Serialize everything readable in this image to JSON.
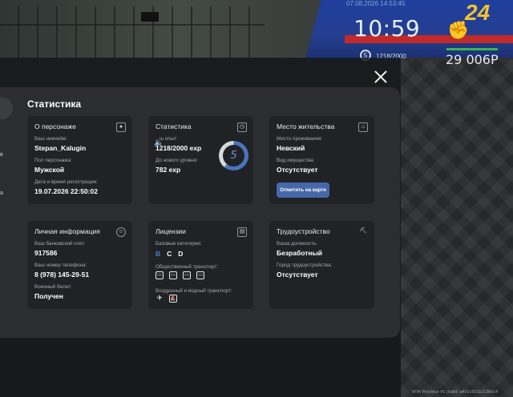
{
  "hud": {
    "date": "07.08.2026 14:53:45",
    "time": "10:59",
    "level": "5",
    "exp": "1218/2000",
    "money": "29 006Р",
    "health_fraction": 1.0,
    "bus_number": "24"
  },
  "left_fragments": [
    "а",
    "в"
  ],
  "title": "Статистика",
  "cards": {
    "personal": {
      "title": "О персонаже",
      "icon": "person-icon",
      "nickname_label": "Ваш никнейм:",
      "nickname": "Stepan_Kalugin",
      "gender_label": "Пол персонажа:",
      "gender": "Мужской",
      "reg_label": "Дата и время регистрации:",
      "reg_date": "19.07.2026 22:50:02"
    },
    "stats": {
      "title": "Статистика",
      "icon": "clock-icon",
      "exp_label": "ш опыт:",
      "exp_value": "1218/2000 exp",
      "next_label": "До нового уровня:",
      "next_value": "782 exp",
      "level": "5",
      "progress_fraction": 0.609
    },
    "residence": {
      "title": "Место жительства",
      "icon": "house-icon",
      "place_label": "Место проживания:",
      "place": "Невский",
      "property_label": "Вид имущества:",
      "property": "Отсутствует",
      "map_button": "Отметить на карте"
    },
    "info": {
      "title": "Личная информация",
      "icon": "face-icon",
      "bank_label": "Ваш банковский счет:",
      "bank": "917586",
      "phone_label": "Ваш номер телефона:",
      "phone": "8 (978) 145-29-51",
      "military_label": "Военный билет:",
      "military": "Получен"
    },
    "licenses": {
      "title": "Лицензии",
      "icon": "license-icon",
      "base_label": "Базовые категории:",
      "categories": [
        "B",
        "C",
        "D"
      ],
      "public_label": "Общественный транспорт:",
      "air_label": "Воздушный и водный транспорт:"
    },
    "employment": {
      "title": "Трудоустройство",
      "icon": "pickaxe-icon",
      "position_label": "Ваша должность:",
      "position": "Безработный",
      "city_label": "Город трудоустройства:",
      "city": "Отсутствует"
    }
  },
  "footer": "MTA Province #1 (build: a491c5011c13b0c4"
}
